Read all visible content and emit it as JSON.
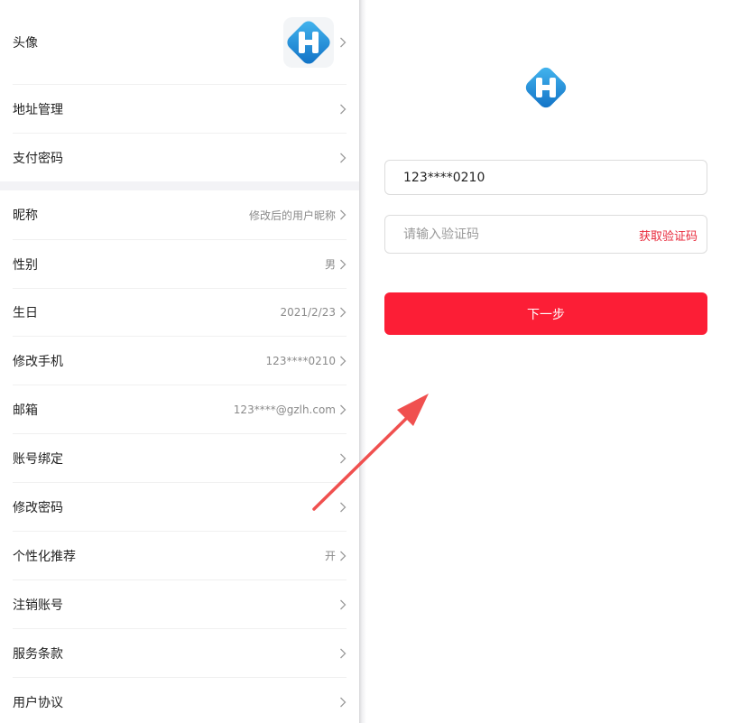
{
  "settings": {
    "avatar_label": "头像",
    "rows_top": [
      {
        "label": "地址管理",
        "value": ""
      },
      {
        "label": "支付密码",
        "value": ""
      }
    ],
    "rows_main": [
      {
        "label": "昵称",
        "value": "修改后的用户昵称"
      },
      {
        "label": "性别",
        "value": "男"
      },
      {
        "label": "生日",
        "value": "2021/2/23"
      },
      {
        "label": "修改手机",
        "value": "123****0210"
      },
      {
        "label": "邮箱",
        "value": "123****@gzlh.com"
      },
      {
        "label": "账号绑定",
        "value": ""
      },
      {
        "label": "修改密码",
        "value": ""
      },
      {
        "label": "个性化推荐",
        "value": "开"
      },
      {
        "label": "注销账号",
        "value": ""
      },
      {
        "label": "服务条款",
        "value": ""
      },
      {
        "label": "用户协议",
        "value": ""
      }
    ]
  },
  "verify": {
    "phone_value": "123****0210",
    "code_placeholder": "请输入验证码",
    "get_code_label": "获取验证码",
    "next_label": "下一步"
  },
  "colors": {
    "accent_red": "#fc1e36",
    "logo_blue": "#1a8ad8",
    "annotation_arrow": "#f0504f"
  },
  "icons": {
    "row_chevron": "chevron-right-icon",
    "app_logo": "app-logo-icon",
    "annotation": "red-arrow-annotation"
  }
}
